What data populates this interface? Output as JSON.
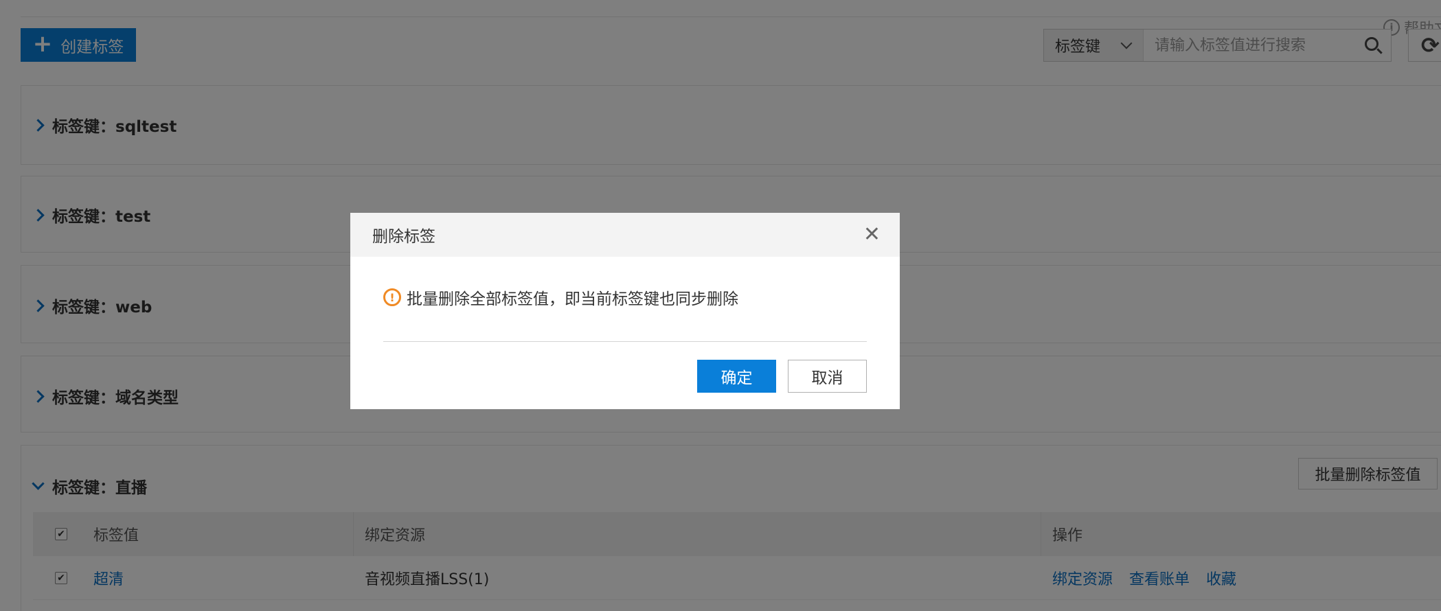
{
  "header": {
    "help_label": "帮助文档",
    "create_button_label": "创建标签",
    "search": {
      "select_value": "标签键",
      "placeholder": "请输入标签值进行搜索"
    }
  },
  "groups": [
    {
      "label": "标签键：sqltest",
      "expanded": false
    },
    {
      "label": "标签键：test",
      "expanded": false
    },
    {
      "label": "标签键：web",
      "expanded": false
    },
    {
      "label": "标签键：域名类型",
      "expanded": false
    },
    {
      "label": "标签键：直播",
      "expanded": true
    }
  ],
  "batch_delete_label": "批量删除标签值",
  "table": {
    "headers": [
      "标签值",
      "绑定资源",
      "操作"
    ],
    "rows": [
      {
        "checked": true,
        "value": "超清",
        "resource": "音视频直播LSS(1)",
        "actions": [
          "绑定资源",
          "查看账单",
          "收藏"
        ]
      }
    ]
  },
  "dialog": {
    "title": "删除标签",
    "message": "批量删除全部标签值，即当前标签键也同步删除",
    "confirm_label": "确定",
    "cancel_label": "取消",
    "warning_color": "#f08a24",
    "primary_color": "#0a7fd9"
  }
}
